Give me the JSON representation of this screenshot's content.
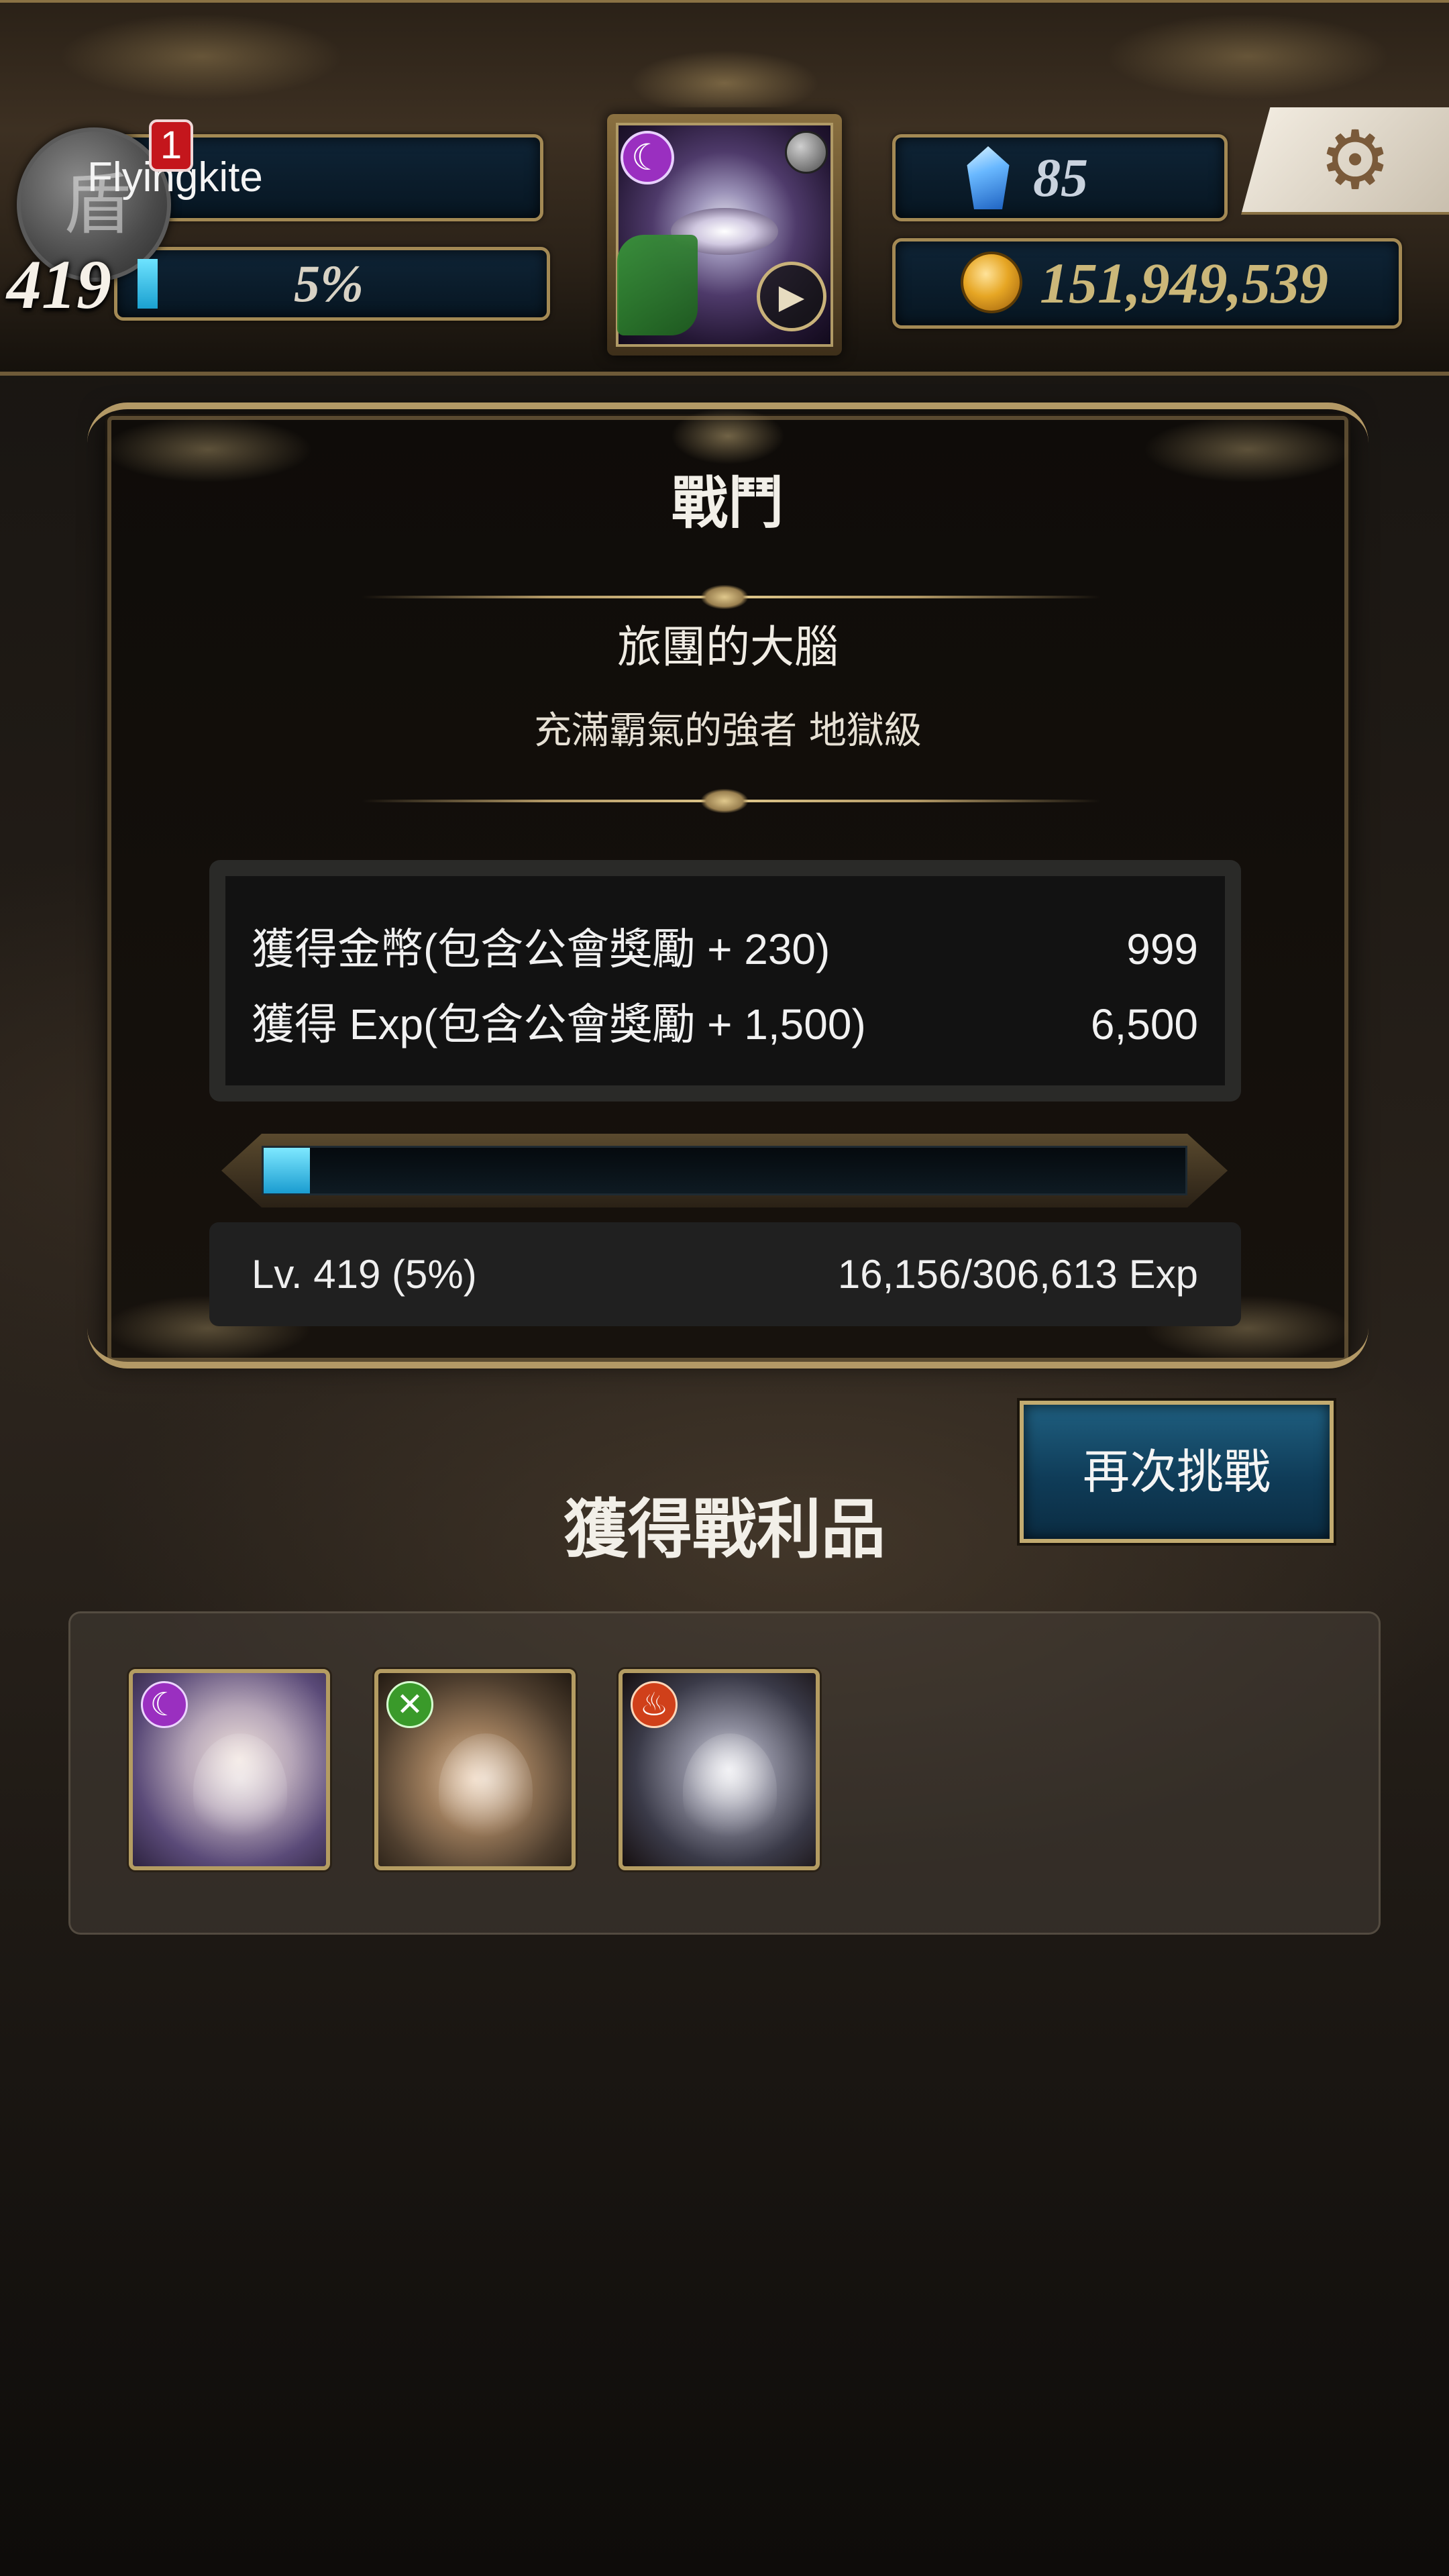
{
  "hud": {
    "player_name": "Flyingkite",
    "notification_count": "1",
    "avatar_glyph": "盾",
    "level": "419",
    "exp_percent_label": "5%",
    "exp_progress": 0.05,
    "gems": "85",
    "coins": "151,949,539",
    "card_play_glyph": "▶",
    "card_attribute_glyph": "☾",
    "settings_glyph": "⚙"
  },
  "battle": {
    "title": "戰鬥",
    "stage_name": "旅團的大腦",
    "stage_difficulty": "充滿霸氣的強者 地獄級",
    "rewards": [
      {
        "label": "獲得金幣(包含公會獎勵 + 230)",
        "value": "999"
      },
      {
        "label": "獲得 Exp(包含公會獎勵 + 1,500)",
        "value": "6,500"
      }
    ],
    "exp_bar_progress": 0.05,
    "level_text": "Lv. 419 (5%)",
    "exp_text": "16,156/306,613 Exp"
  },
  "retry_button_label": "再次挑戰",
  "loot": {
    "title": "獲得戰利品",
    "items": [
      {
        "attribute_glyph": "☾",
        "attribute": "dark"
      },
      {
        "attribute_glyph": "✕",
        "attribute": "wood"
      },
      {
        "attribute_glyph": "♨",
        "attribute": "fire"
      }
    ]
  },
  "colors": {
    "gold_frame": "#b39966",
    "button_blue": "#0f3c58",
    "exp_cyan": "#1a9cd0"
  },
  "icons": [
    "shield-icon",
    "gem-icon",
    "coin-icon",
    "gear-icon",
    "play-icon"
  ]
}
